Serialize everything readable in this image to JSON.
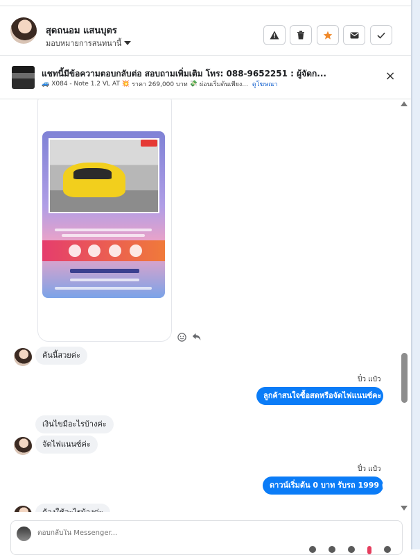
{
  "header": {
    "contact_name": "สุดถนอม แสนบุตร",
    "assign_label": "มอบหมายการสนทนานี้",
    "actions": [
      {
        "icon": "warning-icon"
      },
      {
        "icon": "trash-icon"
      },
      {
        "icon": "star-icon"
      },
      {
        "icon": "mail-icon"
      },
      {
        "icon": "check-icon"
      }
    ]
  },
  "banner": {
    "title": "แชทนี้มีข้อความตอบกลับต่อ สอบถามเพิ่มเติม โทร: 088-9652251 : ผู้จัดก...",
    "car_emoji": "🚙",
    "car": "X084 - Note 1.2 VL AT",
    "price_emoji": "💥",
    "price": "ราคา 269,000 บาท",
    "installment_emoji": "💸",
    "installment": "ผ่อนเริ่มต้นเพียง...",
    "ad_link": "ดูโฆษณา"
  },
  "messages": {
    "m1": "คันนี้สวยค่ะ",
    "sender1": "ปิ๋ว แป๋ว",
    "m2": "ลูกค้าสนใจซื้อสดหรือจัดไฟแนนซ์คะ",
    "m3": "เงินไขมีอะไรบ้างค่ะ",
    "m4": "จัดไฟแนนซ์ค่ะ",
    "sender2": "ปิ๋ว แป๋ว",
    "m5": "ดาวน์เริ่มต้น 0 บาท รับรถ 1999 ค่ะ",
    "m6": "ต้องใช้อะไรบ้างค่ะ"
  },
  "composer": {
    "placeholder": "ตอบกลับใน Messenger..."
  },
  "colors": {
    "accent": "#0b7cf7",
    "star": "#f0892a",
    "link": "#1763cf"
  }
}
